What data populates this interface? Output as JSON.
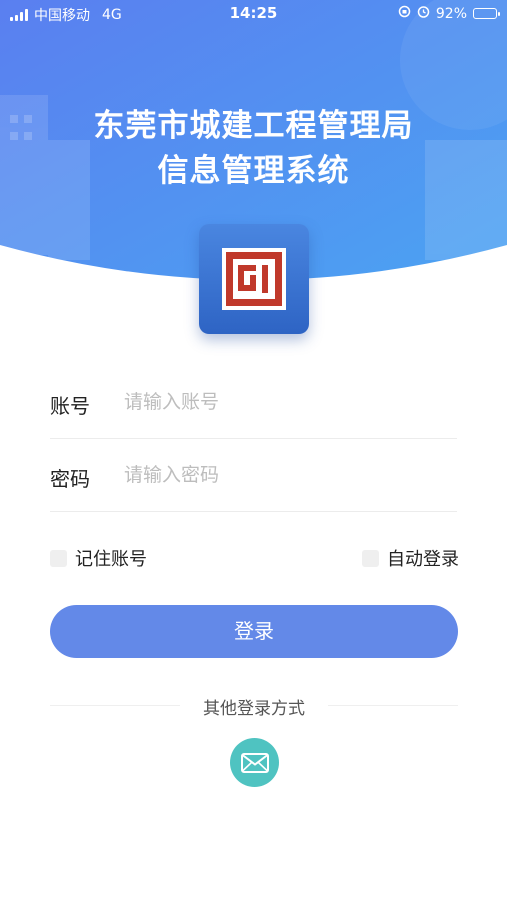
{
  "status_bar": {
    "carrier": "中国移动",
    "network": "4G",
    "time": "14:25",
    "battery": "92%",
    "battery_level": 0.92
  },
  "header": {
    "title_line1": "东莞市城建工程管理局",
    "title_line2": "信息管理系统"
  },
  "form": {
    "account": {
      "label": "账号",
      "placeholder": "请输入账号",
      "value": ""
    },
    "password": {
      "label": "密码",
      "placeholder": "请输入密码",
      "value": ""
    }
  },
  "options": {
    "remember_account": {
      "label": "记住账号",
      "checked": false
    },
    "auto_login": {
      "label": "自动登录",
      "checked": false
    }
  },
  "login_button": "登录",
  "other_login": {
    "label": "其他登录方式",
    "methods": [
      {
        "icon": "mail-icon"
      }
    ]
  },
  "colors": {
    "header_gradient_start": "#5c86f0",
    "header_gradient_end": "#4aa0f0",
    "primary": "#6389e8",
    "mail": "#4fc3c1",
    "logo_red": "#c0392b"
  }
}
